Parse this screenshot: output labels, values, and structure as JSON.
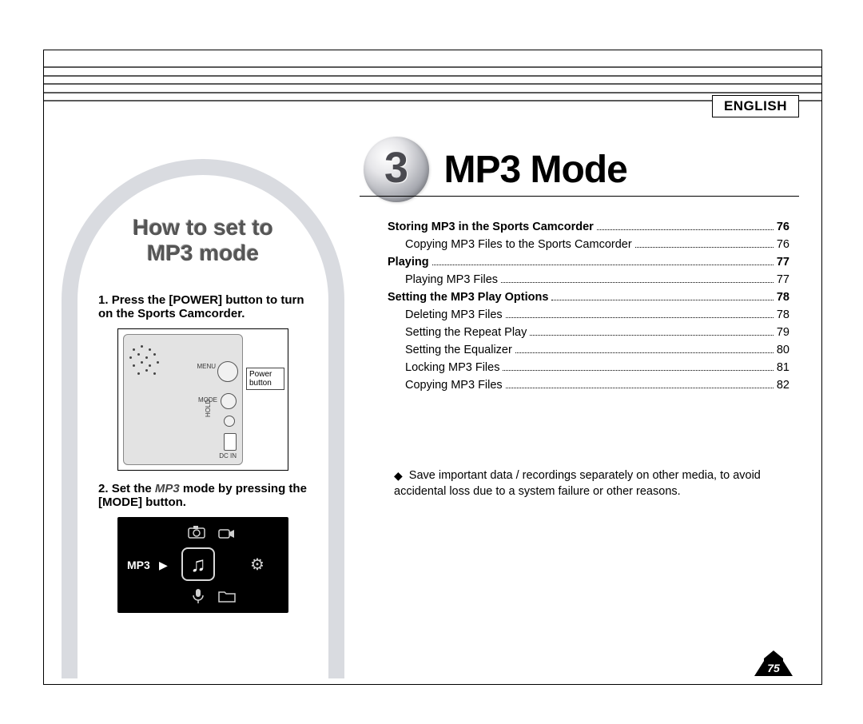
{
  "language": "ENGLISH",
  "chapter": {
    "number": "3",
    "title": "MP3 Mode"
  },
  "page_number": "75",
  "sidebar": {
    "title_line1": "How to set to",
    "title_line2": "MP3 mode",
    "step1_prefix": "1. ",
    "step1_text": "Press the [POWER] button to turn on the Sports Camcorder.",
    "step2_prefix": "2. ",
    "step2_a": "Set the ",
    "step2_mode": "MP3",
    "step2_b": " mode by pressing the [MODE] button.",
    "diagram": {
      "power_label_l1": "Power",
      "power_label_l2": "button",
      "menu_label": "MENU",
      "mode_label": "MODE",
      "hold_label": "HOLD",
      "dcin_label": "DC IN"
    },
    "screen": {
      "label": "MP3"
    }
  },
  "toc": [
    {
      "label": "Storing MP3 in the Sports Camcorder",
      "page": "76",
      "bold": true,
      "sub": false
    },
    {
      "label": "Copying MP3 Files to the Sports Camcorder",
      "page": "76",
      "bold": false,
      "sub": true
    },
    {
      "label": "Playing",
      "page": "77",
      "bold": true,
      "sub": false
    },
    {
      "label": "Playing MP3 Files",
      "page": "77",
      "bold": false,
      "sub": true
    },
    {
      "label": "Setting the MP3 Play Options",
      "page": "78",
      "bold": true,
      "sub": false
    },
    {
      "label": "Deleting MP3 Files",
      "page": "78",
      "bold": false,
      "sub": true
    },
    {
      "label": "Setting the Repeat Play",
      "page": "79",
      "bold": false,
      "sub": true
    },
    {
      "label": "Setting the Equalizer",
      "page": "80",
      "bold": false,
      "sub": true
    },
    {
      "label": "Locking MP3 Files",
      "page": "81",
      "bold": false,
      "sub": true
    },
    {
      "label": "Copying MP3 Files",
      "page": "82",
      "bold": false,
      "sub": true
    }
  ],
  "note": "Save important data / recordings separately on other media, to avoid accidental loss due to a system failure or other reasons."
}
